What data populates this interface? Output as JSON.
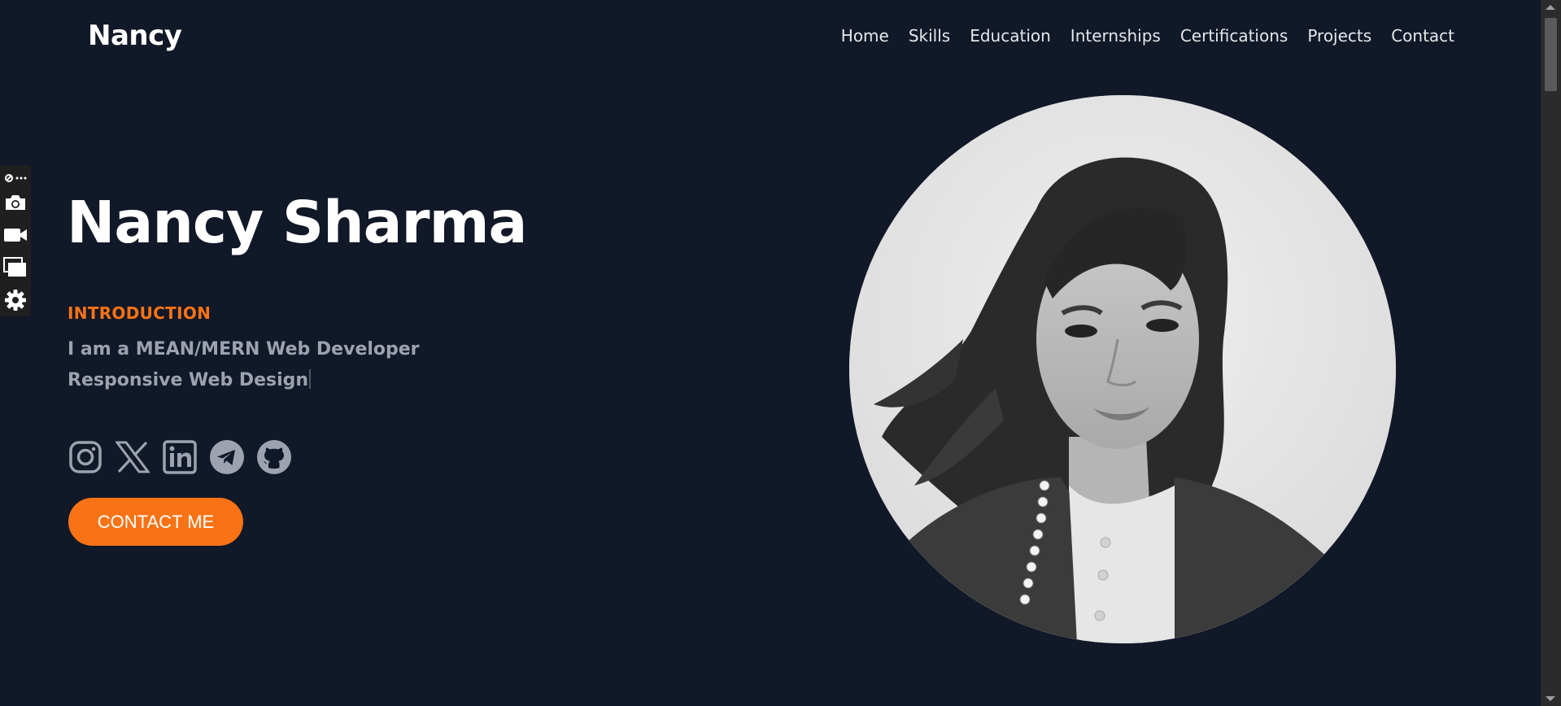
{
  "header": {
    "brand": "Nancy",
    "nav": [
      "Home",
      "Skills",
      "Education",
      "Internships",
      "Certifications",
      "Projects",
      "Contact"
    ]
  },
  "hero": {
    "name": "Nancy Sharma",
    "intro_label": "INTRODUCTION",
    "line1": "I am a MEAN/MERN Web Developer",
    "line2": "Responsive Web Design",
    "cta": "CONTACT ME"
  },
  "socials": [
    "instagram-icon",
    "x-icon",
    "linkedin-icon",
    "telegram-icon",
    "github-icon"
  ],
  "toolbar": [
    "link-more-icon",
    "camera-icon",
    "video-icon",
    "windows-icon",
    "gear-icon"
  ],
  "colors": {
    "background": "#111827",
    "accent": "#f97316",
    "muted_text": "#9ca3af",
    "icon_gray": "#9ca3af"
  }
}
